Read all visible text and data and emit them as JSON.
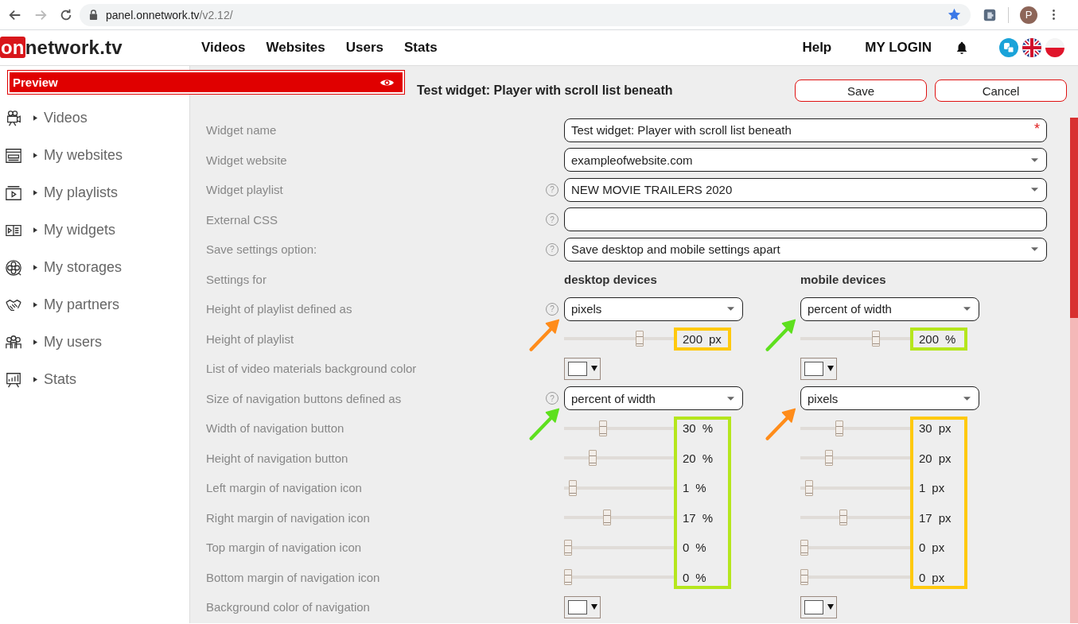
{
  "browser": {
    "url_host": "panel.onnetwork.tv",
    "url_path": "/v2.12/",
    "avatar": "P"
  },
  "header": {
    "logo_on": "on",
    "logo_rest": "network.tv",
    "nav": [
      "Videos",
      "Websites",
      "Users",
      "Stats"
    ],
    "help": "Help",
    "login": "MY LOGIN"
  },
  "preview": {
    "label": "Preview"
  },
  "sidebar": {
    "items": [
      "Videos",
      "My websites",
      "My playlists",
      "My widgets",
      "My storages",
      "My partners",
      "My users",
      "Stats"
    ]
  },
  "page": {
    "title": "Test widget: Player with scroll list beneath",
    "buttons": [
      "Save",
      "Cancel"
    ]
  },
  "form": {
    "rows": [
      {
        "kind": "input",
        "label": "Widget name",
        "value": "Test widget:  Player with scroll list beneath",
        "required_mark": "*"
      },
      {
        "kind": "select",
        "label": "Widget website",
        "value": "exampleofwebsite.com"
      },
      {
        "kind": "select",
        "label": "Widget playlist",
        "help": "?",
        "value": "NEW MOVIE TRAILERS 2020"
      },
      {
        "kind": "input",
        "label": "External CSS",
        "help": "?"
      },
      {
        "kind": "select",
        "label": "Save settings option:",
        "help": "?",
        "value": "Save desktop and mobile settings apart"
      },
      {
        "kind": "header",
        "label": "Settings for",
        "desktop": "desktop devices",
        "mobile": "mobile devices"
      },
      {
        "kind": "dual_select",
        "label": "Height of playlist defined as",
        "help": "?",
        "desktop": {
          "value": "pixels",
          "arrow": {
            "color": "#ff8c1a"
          }
        },
        "mobile": {
          "value": "percent of width",
          "arrow": {
            "color": "#5ee01e"
          }
        }
      },
      {
        "kind": "sliders",
        "desktop_frame": {
          "color": "#ffc90e"
        },
        "mobile_frame": {
          "color": "#b5e61d"
        },
        "rows": [
          {
            "label": "Height of playlist",
            "desktop": {
              "level": 0.7,
              "value": "200",
              "unit": "px"
            },
            "mobile": {
              "level": 0.7,
              "value": "200",
              "unit": "%"
            }
          }
        ]
      },
      {
        "kind": "colors",
        "label": "List of video materials background color"
      },
      {
        "kind": "dual_select",
        "label": "Size of navigation buttons defined as",
        "help": "?",
        "desktop": {
          "value": "percent of width",
          "arrow": {
            "color": "#5ee01e"
          }
        },
        "mobile": {
          "value": "pixels",
          "arrow": {
            "color": "#ff8c1a"
          }
        }
      },
      {
        "kind": "sliders",
        "desktop_frame": {
          "color": "#b5e61d"
        },
        "mobile_frame": {
          "color": "#ffc90e"
        },
        "rows": [
          {
            "label": "Width of navigation button",
            "desktop": {
              "level": 0.34,
              "value": "30",
              "unit": "%"
            },
            "mobile": {
              "level": 0.34,
              "value": "30",
              "unit": "px"
            }
          },
          {
            "label": "Height of navigation button",
            "desktop": {
              "level": 0.24,
              "value": "20",
              "unit": "%"
            },
            "mobile": {
              "level": 0.24,
              "value": "20",
              "unit": "px"
            }
          },
          {
            "label": "Left margin of navigation icon",
            "desktop": {
              "level": 0.05,
              "value": "1",
              "unit": "%"
            },
            "mobile": {
              "level": 0.05,
              "value": "1",
              "unit": "px"
            }
          },
          {
            "label": "Right margin of navigation icon",
            "desktop": {
              "level": 0.38,
              "value": "17",
              "unit": "%"
            },
            "mobile": {
              "level": 0.38,
              "value": "17",
              "unit": "px"
            }
          },
          {
            "label": "Top margin of navigation icon",
            "desktop": {
              "level": 0.0,
              "value": "0",
              "unit": "%"
            },
            "mobile": {
              "level": 0.0,
              "value": "0",
              "unit": "px"
            }
          },
          {
            "label": "Bottom margin of navigation icon",
            "desktop": {
              "level": 0.0,
              "value": "0",
              "unit": "%"
            },
            "mobile": {
              "level": 0.0,
              "value": "0",
              "unit": "px"
            }
          }
        ]
      },
      {
        "kind": "colors",
        "label": "Background color of navigation"
      }
    ]
  }
}
